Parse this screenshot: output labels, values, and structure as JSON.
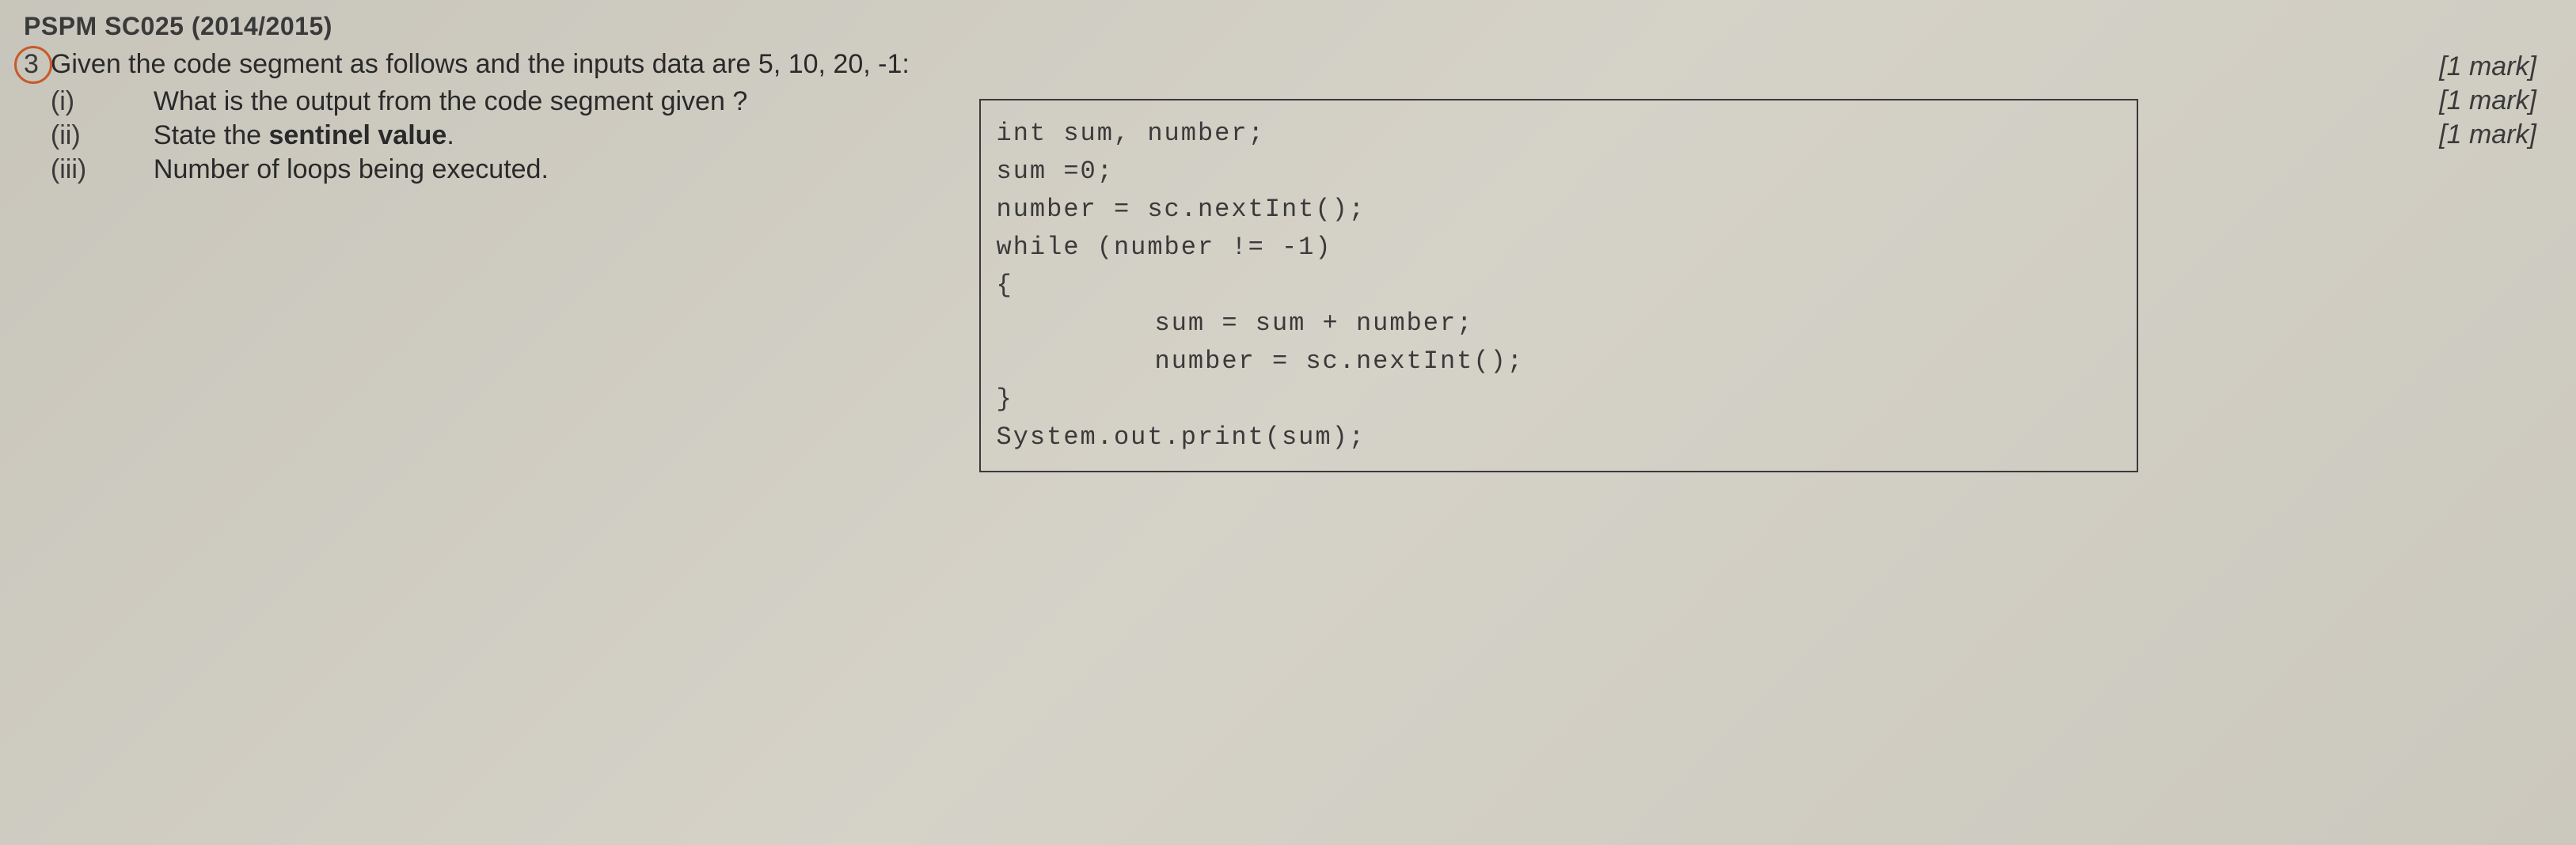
{
  "header": "PSPM SC025 (2014/2015)",
  "question": {
    "number": "3",
    "intro": "Given the code segment as follows and the inputs data are 5, 10, 20, -1:",
    "parts": [
      {
        "label": "(i)",
        "text_before": "What is the output from the code segment given ?",
        "bold": ""
      },
      {
        "label": "(ii)",
        "text_before": "State the ",
        "bold": "sentinel value",
        "text_after": "."
      },
      {
        "label": "(iii)",
        "text_before": "Number of loops being executed.",
        "bold": ""
      }
    ]
  },
  "marks": [
    "[1 mark]",
    "[1 mark]",
    "[1 mark]"
  ],
  "code": {
    "lines": [
      {
        "text": "int sum, number;",
        "indent": false
      },
      {
        "text": "sum =0;",
        "indent": false
      },
      {
        "text": "number = sc.nextInt();",
        "indent": false
      },
      {
        "text": "while (number != -1)",
        "indent": false
      },
      {
        "text": "{",
        "indent": false
      },
      {
        "text": "sum = sum + number;",
        "indent": true
      },
      {
        "text": "number = sc.nextInt();",
        "indent": true
      },
      {
        "text": "}",
        "indent": false
      },
      {
        "text": "System.out.print(sum);",
        "indent": false
      }
    ]
  }
}
